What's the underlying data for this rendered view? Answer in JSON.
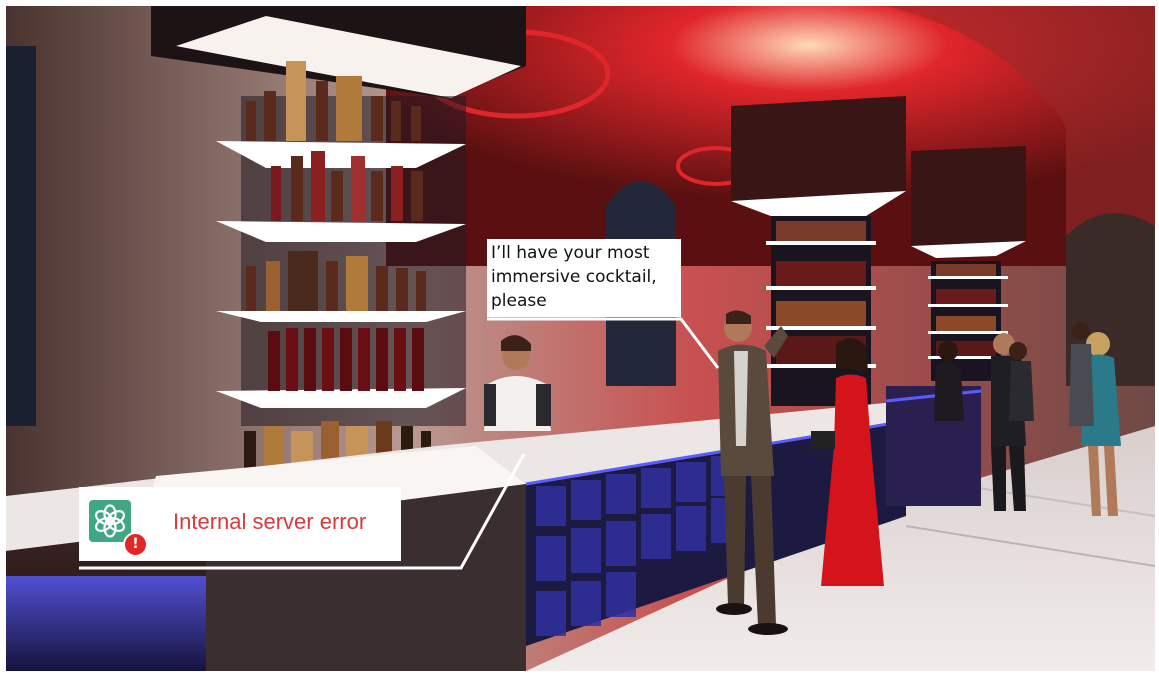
{
  "speech_bubble": {
    "lines": [
      "I’ll have your most",
      "immersive cocktail,",
      "please"
    ]
  },
  "error_card": {
    "message": "Internal server error",
    "icon": "chatgpt-logo-icon",
    "badge_icon": "alert-icon",
    "badge_symbol": "!",
    "message_color": "#d93a3a",
    "icon_color": "#3fa882",
    "badge_color": "#e22525"
  },
  "scene": {
    "accent_red": "#e0262b",
    "accent_blue": "#3b3cff"
  }
}
